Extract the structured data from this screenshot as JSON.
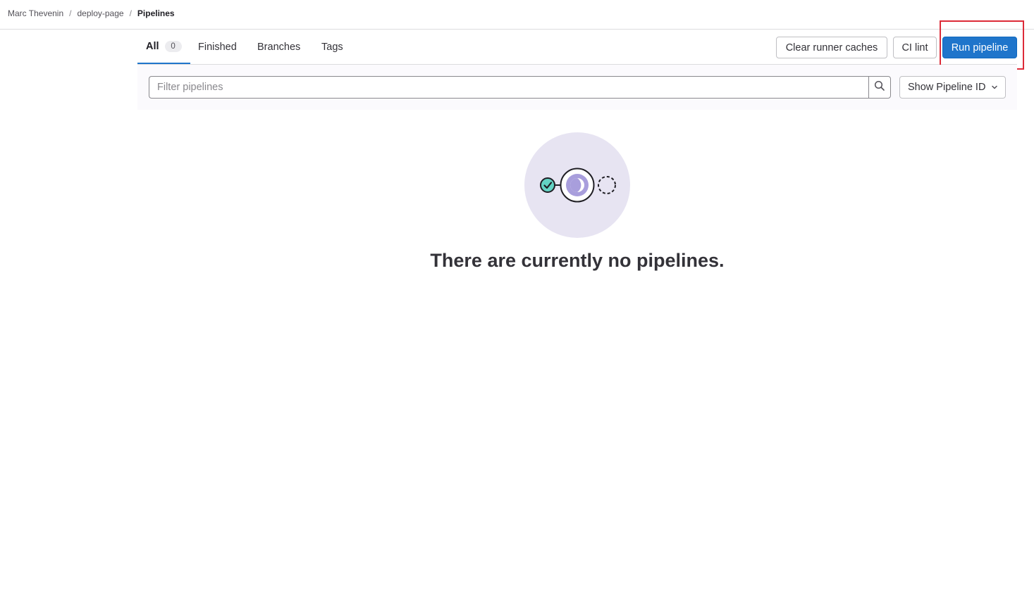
{
  "breadcrumb": {
    "items": [
      "Marc Thevenin",
      "deploy-page"
    ],
    "separator": "/",
    "current": "Pipelines"
  },
  "tabs": [
    {
      "label": "All",
      "count": "0",
      "active": true
    },
    {
      "label": "Finished"
    },
    {
      "label": "Branches"
    },
    {
      "label": "Tags"
    }
  ],
  "actions": {
    "clear_caches_label": "Clear runner caches",
    "ci_lint_label": "CI lint",
    "run_pipeline_label": "Run pipeline"
  },
  "filter": {
    "placeholder": "Filter pipelines",
    "value": "",
    "search_icon": "search-icon",
    "dropdown_label": "Show Pipeline ID",
    "dropdown_icon": "chevron-down-icon"
  },
  "empty_state": {
    "title": "There are currently no pipelines.",
    "illustration": "pipeline-illustration"
  },
  "colors": {
    "primary": "#1f75cb",
    "highlight": "#dd2b38",
    "illustration_bg": "#e7e4f2",
    "success": "#63d3c4",
    "running": "#a89edc"
  }
}
